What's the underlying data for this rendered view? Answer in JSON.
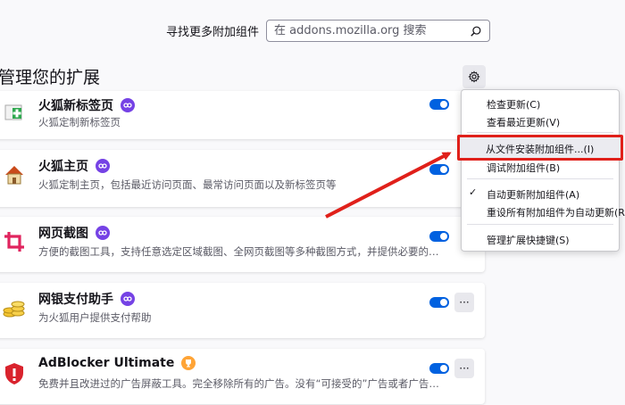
{
  "search": {
    "label": "寻找更多附加组件",
    "placeholder": "在 addons.mozilla.org 搜索"
  },
  "page_title": "管理您的扩展",
  "extensions": [
    {
      "name": "火狐新标签页",
      "desc": "火狐定制新标签页",
      "badge": "recommended",
      "icon": "new-tab-plus-icon",
      "enabled": true
    },
    {
      "name": "火狐主页",
      "desc": "火狐定制主页，包括最近访问页面、最常访问页面以及新标签页等",
      "badge": "recommended",
      "icon": "home-icon",
      "enabled": true
    },
    {
      "name": "网页截图",
      "desc": "方便的截图工具，支持任意选定区域截图、全网页截图等多种截图方式，并提供必要的图片…",
      "badge": "recommended",
      "icon": "crop-icon",
      "enabled": true
    },
    {
      "name": "网银支付助手",
      "desc": "为火狐用户提供支付帮助",
      "badge": "recommended",
      "icon": "coins-icon",
      "enabled": true
    },
    {
      "name": "AdBlocker Ultimate",
      "desc": "免费并且改进过的广告屏蔽工具。完全移除所有的广告。没有“可接受的”广告或者广告商…",
      "badge": "line",
      "icon": "shield-icon",
      "enabled": true
    }
  ],
  "more_label": "···",
  "menu": {
    "check_updates": "检查更新(C)",
    "view_recent": "查看最近更新(V)",
    "install_from_file": "从文件安装附加组件...(I)",
    "debug_addons": "调试附加组件(B)",
    "auto_update": "自动更新附加组件(A)",
    "reset_auto": "重设所有附加组件为自动更新(R)",
    "manage_shortcuts": "管理扩展快捷键(S)",
    "check_mark": "✓"
  },
  "colors": {
    "accent": "#0061e0",
    "highlight_border": "#e0201a",
    "badge_recommended": "#7542e5",
    "badge_line": "#ffa436"
  }
}
